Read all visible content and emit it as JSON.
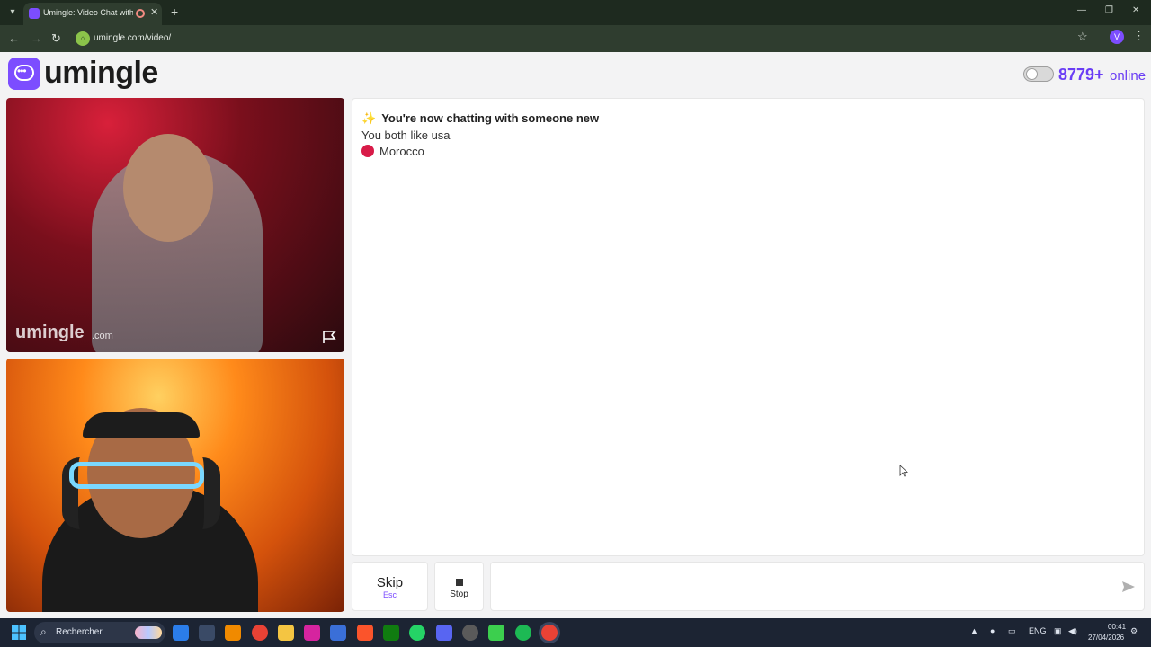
{
  "browser": {
    "tab_title": "Umingle: Video Chat with St",
    "url": "umingle.com/video/",
    "profile_initial": "V"
  },
  "header": {
    "logo_text": "umingle",
    "online_count": "8779+",
    "online_label": "online",
    "toggle_on": false
  },
  "video": {
    "watermark": "umingle",
    "watermark_domain": ".com"
  },
  "chat": {
    "intro": "You're now chatting with someone new",
    "common_interest": "You both like usa",
    "country": "Morocco"
  },
  "controls": {
    "skip_label": "Skip",
    "skip_key": "Esc",
    "stop_label": "Stop",
    "message_placeholder": ""
  },
  "taskbar": {
    "search_label": "Rechercher",
    "language": "ENG",
    "time": "00:41",
    "date": "27/04/2026"
  },
  "colors": {
    "brand": "#7c4dff",
    "online_text": "#6a3df5",
    "country_dot": "#d81b48"
  }
}
